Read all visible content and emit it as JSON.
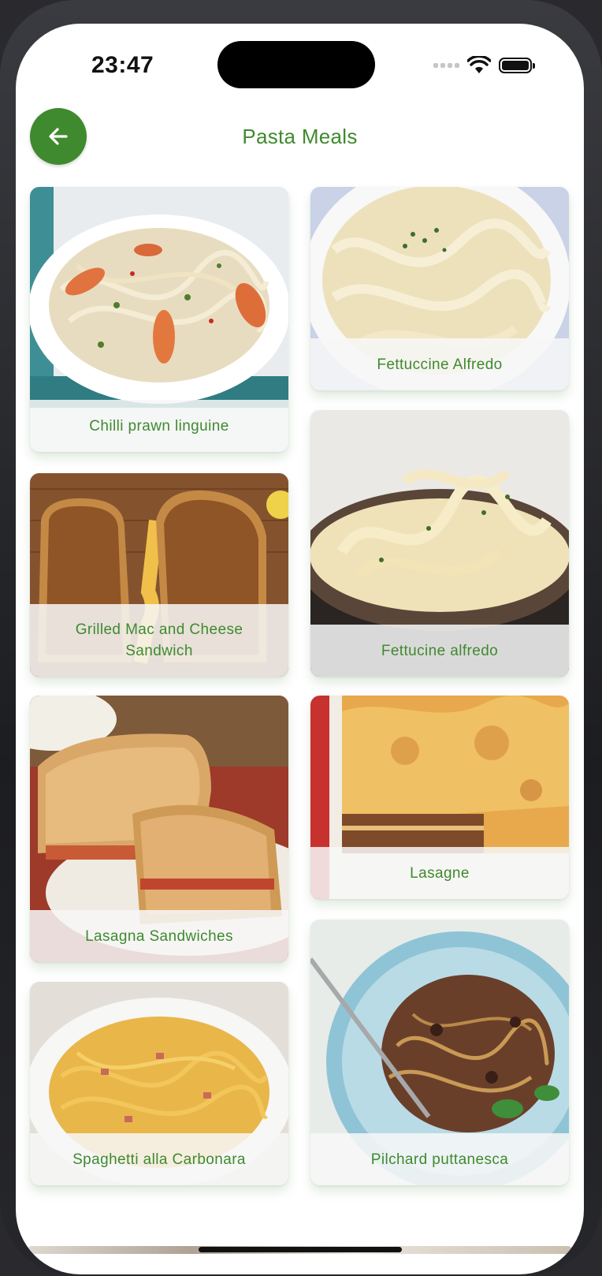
{
  "status_bar": {
    "time": "23:47"
  },
  "app_bar": {
    "title": "Pasta Meals"
  },
  "meals": [
    {
      "name": "Chilli prawn linguine"
    },
    {
      "name": "Fettuccine Alfredo"
    },
    {
      "name": "Grilled Mac and Cheese Sandwich"
    },
    {
      "name": "Fettucine alfredo"
    },
    {
      "name": "Lasagna Sandwiches"
    },
    {
      "name": "Lasagne"
    },
    {
      "name": "Spaghetti alla Carbonara"
    },
    {
      "name": "Pilchard puttanesca"
    }
  ],
  "colors": {
    "accent": "#3f8a2f",
    "caption_bg": "#f7f7f7"
  }
}
